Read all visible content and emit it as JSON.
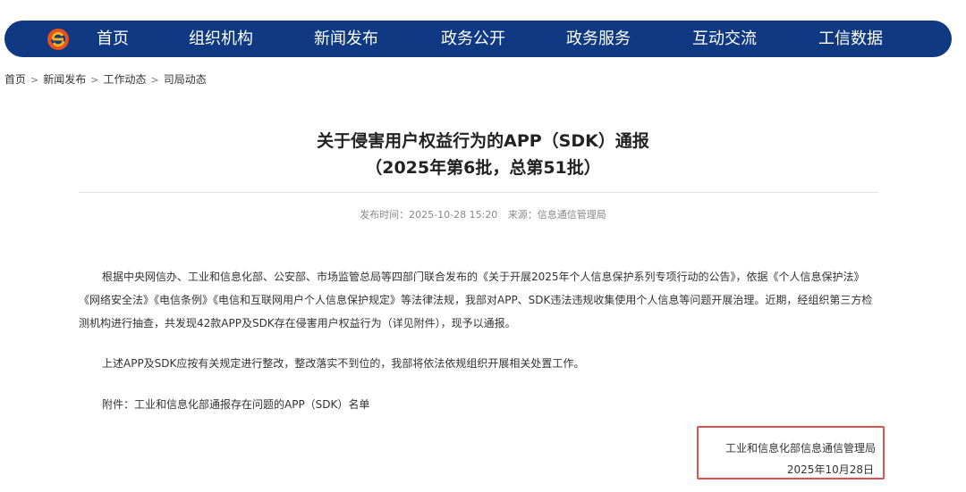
{
  "nav": {
    "items": [
      {
        "label": "首页"
      },
      {
        "label": "组织机构"
      },
      {
        "label": "新闻发布"
      },
      {
        "label": "政务公开"
      },
      {
        "label": "政务服务"
      },
      {
        "label": "互动交流"
      },
      {
        "label": "工信数据"
      }
    ],
    "logo_icon": "miit-logo-icon",
    "background": "#0f3a83"
  },
  "breadcrumb": {
    "items": [
      "首页",
      "新闻发布",
      "工作动态",
      "司局动态"
    ],
    "separator": ">"
  },
  "article": {
    "title_line1": "关于侵害用户权益行为的APP（SDK）通报",
    "title_line2": "（2025年第6批，总第51批）",
    "publish_label": "发布时间：2025-10-28 15:20",
    "source_label": "来源：信息通信管理局",
    "paragraphs": [
      "根据中央网信办、工业和信息化部、公安部、市场监管总局等四部门联合发布的《关于开展2025年个人信息保护系列专项行动的公告》，依据《个人信息保护法》《网络安全法》《电信条例》《电信和互联网用户个人信息保护规定》等法律法规，我部对APP、SDK违法违规收集使用个人信息等问题开展治理。近期，经组织第三方检测机构进行抽查，共发现42款APP及SDK存在侵害用户权益行为（详见附件），现予以通报。",
      "上述APP及SDK应按有关规定进行整改，整改落实不到位的，我部将依法依规组织开展相关处置工作。",
      "附件：工业和信息化部通报存在问题的APP（SDK）名单"
    ],
    "signature_org": "工业和信息化部信息通信管理局",
    "signature_date": "2025年10月28日",
    "highlight_color": "#d9534f"
  }
}
